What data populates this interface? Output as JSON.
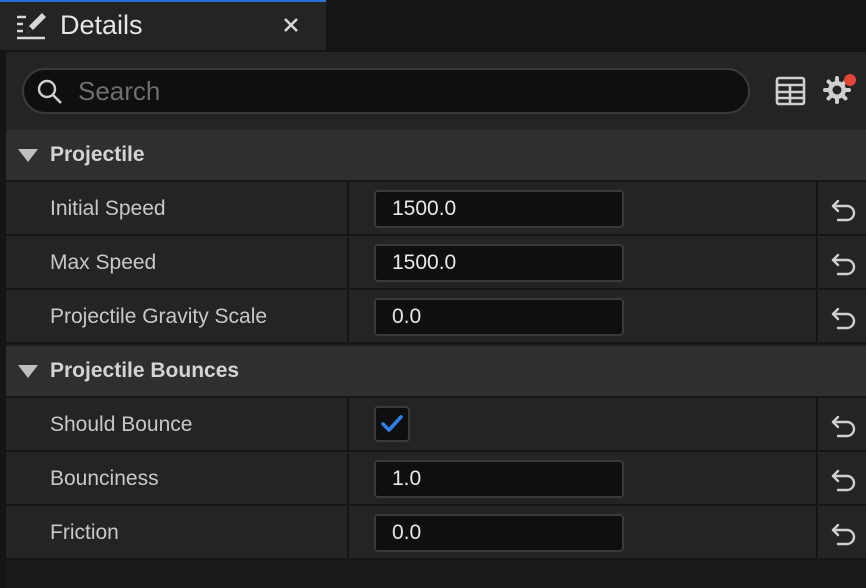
{
  "tab": {
    "title": "Details",
    "icon": "edit-details-icon",
    "close_icon": "close-icon"
  },
  "search": {
    "placeholder": "Search",
    "value": ""
  },
  "toolbar": {
    "table_view_icon": "table-view-icon",
    "settings_icon": "settings-gear-icon",
    "notification_color": "#e0453a"
  },
  "colors": {
    "accent": "#2a6fd6",
    "checkbox_check": "#2f7fe6"
  },
  "categories": [
    {
      "label": "Projectile",
      "properties": [
        {
          "name": "Initial Speed",
          "value": "1500.0"
        },
        {
          "name": "Max Speed",
          "value": "1500.0"
        },
        {
          "name": "Projectile Gravity Scale",
          "value": "0.0"
        }
      ]
    },
    {
      "label": "Projectile Bounces",
      "properties": [
        {
          "name": "Should Bounce",
          "checked": true
        },
        {
          "name": "Bounciness",
          "value": "1.0"
        },
        {
          "name": "Friction",
          "value": "0.0"
        }
      ]
    }
  ]
}
